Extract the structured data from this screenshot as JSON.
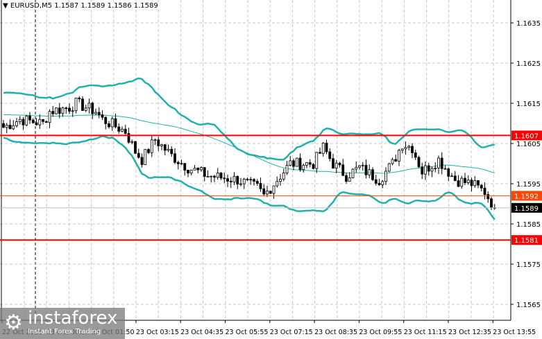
{
  "header": {
    "symbol": "EURUSD,M5",
    "open": "1.1587",
    "high": "1.1589",
    "low": "1.1586",
    "close": "1.1589"
  },
  "logo": {
    "name": "instaforex",
    "tagline": "Instant Forex Trading"
  },
  "chart_data": {
    "type": "candlestick",
    "title": "EURUSD,M5",
    "ylim": [
      1.1565,
      1.1635
    ],
    "yticks": [
      "1.1635",
      "1.1625",
      "1.1615",
      "1.1605",
      "1.1595",
      "1.1585",
      "1.1575",
      "1.1565"
    ],
    "xticks": [
      "22 Oct 2025",
      "23 Oct 00:30",
      "23 Oct 01:50",
      "23 Oct 03:15",
      "23 Oct 04:35",
      "23 Oct 05:55",
      "23 Oct 07:15",
      "23 Oct 08:35",
      "23 Oct 09:55",
      "23 Oct 11:15",
      "23 Oct 12:35",
      "23 Oct 13:55"
    ],
    "bar_count": 150,
    "close_waypoints": [
      [
        0,
        1.1609
      ],
      [
        5,
        1.1611
      ],
      [
        12,
        1.161
      ],
      [
        14,
        1.1613
      ],
      [
        20,
        1.1614
      ],
      [
        22,
        1.1615
      ],
      [
        28,
        1.1613
      ],
      [
        30,
        1.1611
      ],
      [
        37,
        1.1608
      ],
      [
        40,
        1.1603
      ],
      [
        42,
        1.1601
      ],
      [
        46,
        1.1606
      ],
      [
        51,
        1.1602
      ],
      [
        56,
        1.1599
      ],
      [
        62,
        1.1597
      ],
      [
        71,
        1.1596
      ],
      [
        77,
        1.1594
      ],
      [
        79,
        1.1592
      ],
      [
        83,
        1.1596
      ],
      [
        87,
        1.16
      ],
      [
        94,
        1.16
      ],
      [
        97,
        1.1604
      ],
      [
        100,
        1.16
      ],
      [
        104,
        1.1597
      ],
      [
        108,
        1.1599
      ],
      [
        114,
        1.1596
      ],
      [
        118,
        1.16
      ],
      [
        121,
        1.1605
      ],
      [
        124,
        1.1604
      ],
      [
        127,
        1.1598
      ],
      [
        132,
        1.1601
      ],
      [
        137,
        1.1596
      ],
      [
        142,
        1.1595
      ],
      [
        146,
        1.1593
      ],
      [
        149,
        1.1589
      ]
    ],
    "levels": [
      {
        "price": "1.1607",
        "color": "#ff0000"
      },
      {
        "price": "1.1592",
        "color": "#ff4500"
      },
      {
        "price": "1.1581",
        "color": "#ff0000"
      }
    ],
    "current_price": "1.1589",
    "indicators": [
      "Bollinger Bands",
      "Moving Average"
    ],
    "band_color": "#20b2aa"
  }
}
